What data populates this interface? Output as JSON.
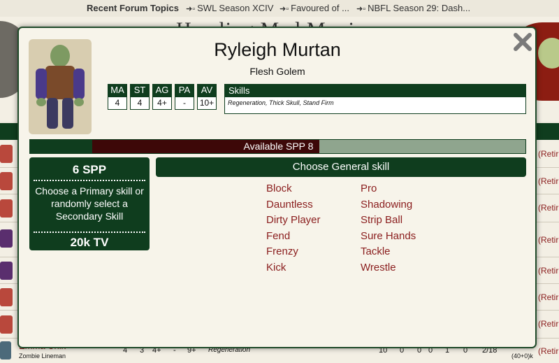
{
  "topbar": {
    "recent_forum_topics": "Recent Forum Topics",
    "topics": [
      {
        "title": "SWL Season XCIV"
      },
      {
        "title": "Favoured of ..."
      },
      {
        "title": "NBFL Season 29: Dash..."
      }
    ]
  },
  "background": {
    "team_title": "Howling Mad Moxie",
    "retire_label": "(Retir",
    "last_row": {
      "name": "Emma Chik",
      "position": "Zombie Lineman",
      "ma": "4",
      "st": "3",
      "ag": "4+",
      "pa": "-",
      "av": "9+",
      "skills": "Regeneration",
      "stats": [
        "10",
        "0",
        "0",
        "0",
        "1",
        "0"
      ],
      "spp": "2/18",
      "value": "40k",
      "value_breakdown": "(40+0)k"
    }
  },
  "modal": {
    "player_name": "Ryleigh Murtan",
    "position": "Flesh Golem",
    "stats": [
      {
        "label": "MA",
        "value": "4"
      },
      {
        "label": "ST",
        "value": "4"
      },
      {
        "label": "AG",
        "value": "4+"
      },
      {
        "label": "PA",
        "value": "-"
      },
      {
        "label": "AV",
        "value": "10+"
      }
    ],
    "skills_header": "Skills",
    "skills_list": "Regeneration, Thick Skull, Stand Firm",
    "spp_bar": {
      "label": "Available SPP 8",
      "available_spp": 8
    },
    "cost_card": {
      "spp": "6 SPP",
      "description": "Choose a Primary skill or randomly select a Secondary Skill",
      "tv": "20k TV"
    },
    "choose_button": "Choose General skill",
    "skills_col1": [
      "Block",
      "Dauntless",
      "Dirty Player",
      "Fend",
      "Frenzy",
      "Kick"
    ],
    "skills_col2": [
      "Pro",
      "Shadowing",
      "Strip Ball",
      "Sure Hands",
      "Tackle",
      "Wrestle"
    ]
  },
  "colors": {
    "dark_green": "#0f3d1e",
    "maroon": "#3d0808",
    "skill_link": "#8a1d1d",
    "modal_bg": "#f7f4ea"
  }
}
